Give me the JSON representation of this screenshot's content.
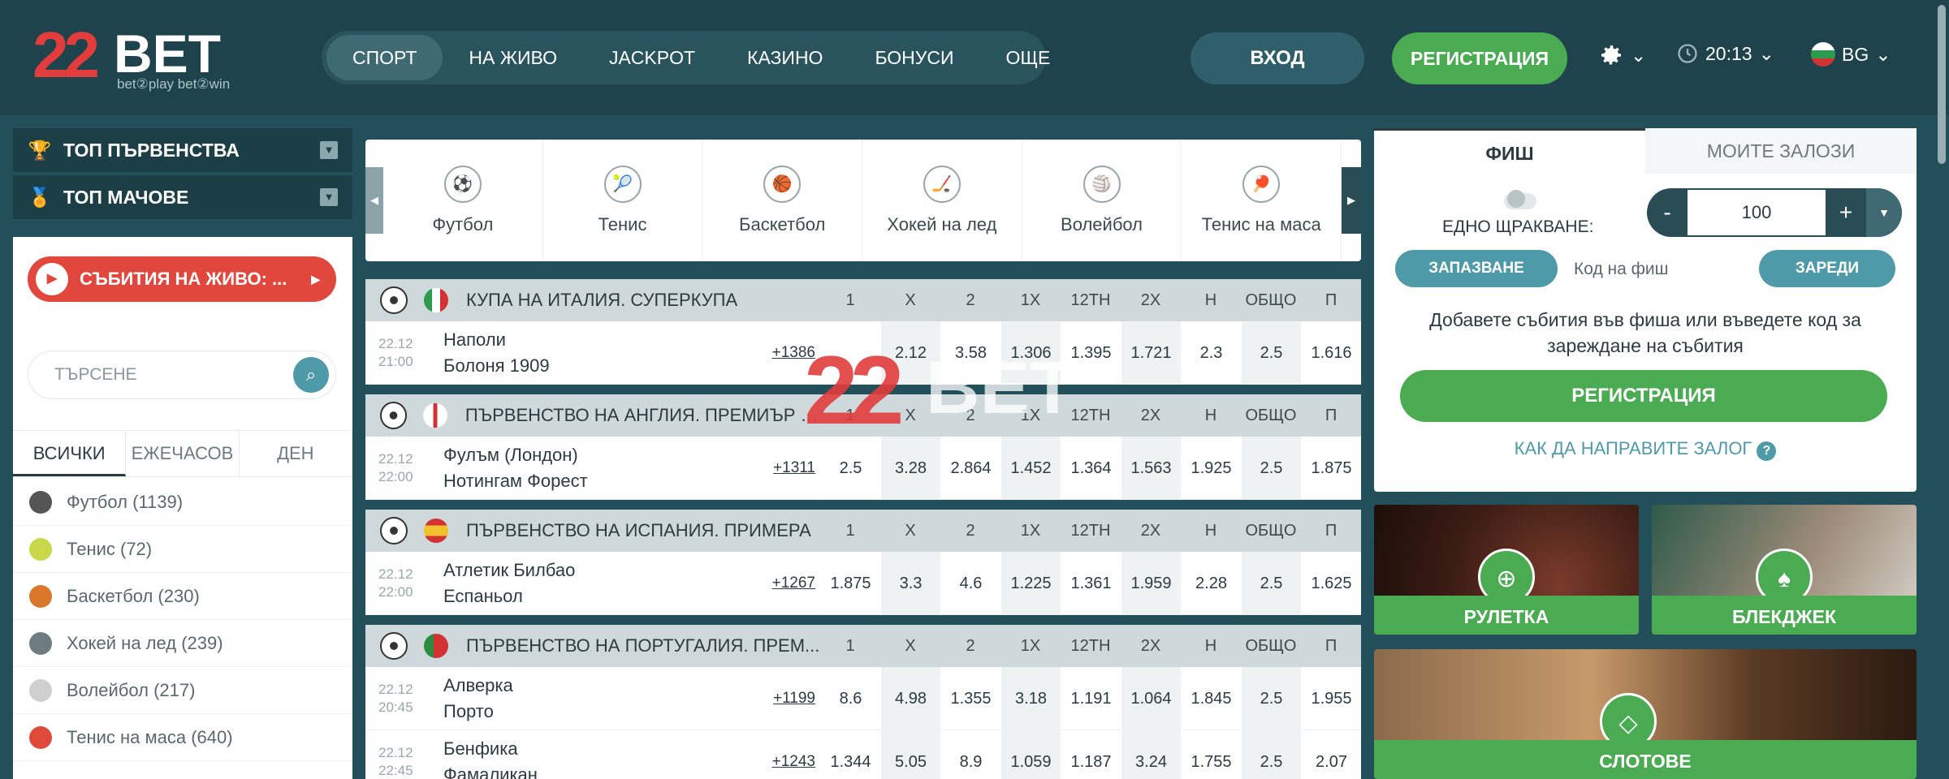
{
  "logo": {
    "num": "22",
    "word": "BET",
    "tagline": "bet②play  bet②win"
  },
  "nav": [
    "СПОРТ",
    "НА ЖИВО",
    "JACKPOT",
    "КАЗИНО",
    "БОНУСИ",
    "ОЩЕ"
  ],
  "header": {
    "login": "ВХОД",
    "register": "РЕГИСТРАЦИЯ",
    "time": "20:13",
    "lang": "BG",
    "chevron": "⌄"
  },
  "sidebar": {
    "top_leagues": "ТОП ПЪРВЕНСТВА",
    "top_matches": "ТОП МАЧОВЕ",
    "live": "СЪБИТИЯ НА ЖИВО: ...",
    "search_placeholder": "ТЪРСЕНЕ",
    "filters": [
      "ВСИЧКИ",
      "ЕЖЕЧАСОВ",
      "ДЕН"
    ],
    "sports": [
      {
        "label": "Футбол (1139)",
        "color": "#555555"
      },
      {
        "label": "Тенис (72)",
        "color": "#c9d84a"
      },
      {
        "label": "Баскетбол (230)",
        "color": "#d9772b"
      },
      {
        "label": "Хокей на лед (239)",
        "color": "#6e7c80"
      },
      {
        "label": "Волейбол (217)",
        "color": "#cfcfcf"
      },
      {
        "label": "Тенис на маса (640)",
        "color": "#e04a3a"
      }
    ]
  },
  "carousel": [
    "Футбол",
    "Тенис",
    "Баскетбол",
    "Хокей на лед",
    "Волейбол",
    "Тенис на маса"
  ],
  "columns": [
    "1",
    "X",
    "2",
    "1X",
    "12ТН",
    "2X",
    "Н",
    "ОБЩО",
    "П"
  ],
  "leagues": [
    {
      "name": "КУПА НА ИТАЛИЯ. СУПЕРКУПА",
      "flag": "linear-gradient(90deg,#2d9b4f 0 33%,#fff 33% 66%,#d23232 66%)",
      "matches": [
        {
          "date": "22.12",
          "time": "21:00",
          "home": "Наполи",
          "away": "Болоня 1909",
          "more": "+1386",
          "odds": [
            "2.12",
            "3.58",
            "1.306",
            "1.395",
            "1.721",
            "2.3",
            "2.5",
            "1.616"
          ]
        }
      ]
    },
    {
      "name": "ПЪРВЕНСТВО НА АНГЛИЯ. ПРЕМИЪР Л...",
      "flag": "linear-gradient(90deg,#fff 0 42%,#d23232 42% 58%,#fff 58%)",
      "matches": [
        {
          "date": "22.12",
          "time": "22:00",
          "home": "Фулъм (Лондон)",
          "away": "Нотингам Форест",
          "more": "+1311",
          "odds": [
            "2.5",
            "3.28",
            "2.864",
            "1.452",
            "1.364",
            "1.563",
            "1.925",
            "2.5",
            "1.875"
          ]
        }
      ]
    },
    {
      "name": "ПЪРВЕНСТВО НА ИСПАНИЯ. ПРИМЕРА",
      "flag": "linear-gradient(#d23232 0 28%,#f2c12e 28% 72%,#d23232 72%)",
      "matches": [
        {
          "date": "22.12",
          "time": "22:00",
          "home": "Атлетик Билбао",
          "away": "Еспаньол",
          "more": "+1267",
          "odds": [
            "1.875",
            "3.3",
            "4.6",
            "1.225",
            "1.361",
            "1.959",
            "2.28",
            "2.5",
            "1.625"
          ]
        }
      ]
    },
    {
      "name": "ПЪРВЕНСТВО НА ПОРТУГАЛИЯ. ПРЕМ...",
      "flag": "linear-gradient(90deg,#2d8a3e 0 40%,#d23232 40%)",
      "matches": [
        {
          "date": "22.12",
          "time": "20:45",
          "home": "Алверка",
          "away": "Порто",
          "more": "+1199",
          "odds": [
            "8.6",
            "4.98",
            "1.355",
            "3.18",
            "1.191",
            "1.064",
            "1.845",
            "2.5",
            "1.955"
          ]
        },
        {
          "date": "22.12",
          "time": "22:45",
          "home": "Бенфика",
          "away": "Фамаликан",
          "more": "+1243",
          "odds": [
            "1.344",
            "5.05",
            "8.9",
            "1.059",
            "1.187",
            "3.24",
            "1.755",
            "2.5",
            "2.07"
          ]
        }
      ]
    }
  ],
  "watermark": {
    "num": "22",
    "word": "BET"
  },
  "betslip": {
    "tabs": [
      "ФИШ",
      "МОИТЕ ЗАЛОЗИ"
    ],
    "one_click": "ЕДНО ЩРАКВАНЕ:",
    "stake": "100",
    "minus": "-",
    "plus": "+",
    "save": "ЗАПАЗВАНЕ",
    "code_placeholder": "Код на фиш",
    "load": "ЗАРЕДИ",
    "hint": "Добавете събития във фиша или въведете код за зареждане на събития",
    "register": "РЕГИСТРАЦИЯ",
    "how_to": "КАК ДА НАПРАВИТЕ ЗАЛОГ"
  },
  "tiles": {
    "roulette": "РУЛЕТКА",
    "blackjack": "БЛЕКДЖЕК",
    "slots": "СЛОТОВЕ"
  }
}
